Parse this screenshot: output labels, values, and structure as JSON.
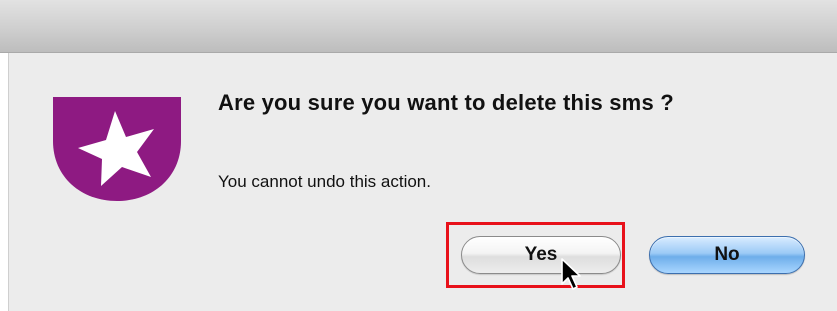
{
  "dialog": {
    "title": "Are you sure you want to delete this sms ?",
    "message": "You cannot undo this action.",
    "app_icon": "star-app-icon",
    "buttons": {
      "yes_label": "Yes",
      "no_label": "No"
    }
  },
  "annotation": {
    "highlight_color": "#e8111a",
    "highlighted_target": "yes-button"
  },
  "colors": {
    "icon_purple": "#8e1a82",
    "default_button_blue": "#6eaeea"
  }
}
